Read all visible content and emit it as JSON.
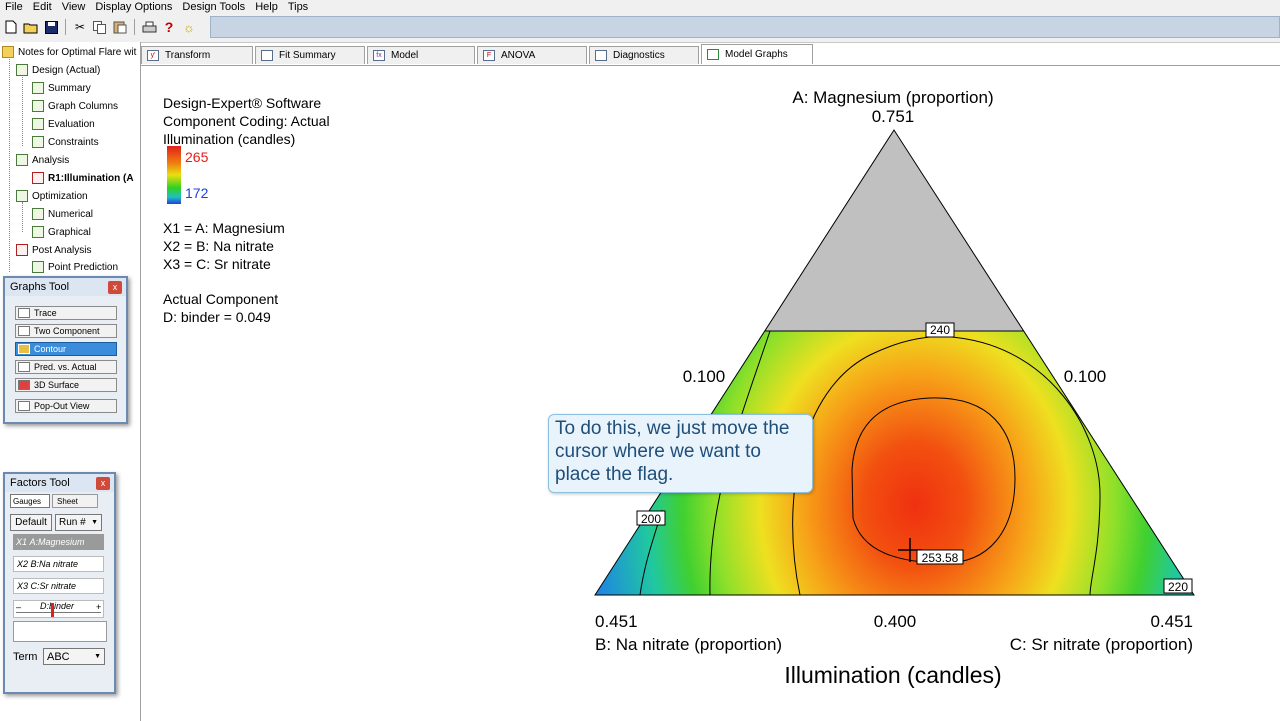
{
  "menu": [
    "File",
    "Edit",
    "View",
    "Display Options",
    "Design Tools",
    "Help",
    "Tips"
  ],
  "tree": {
    "root": "Notes for Optimal Flare wit",
    "items": [
      {
        "label": "Design (Actual)",
        "level": 1
      },
      {
        "label": "Summary",
        "level": 2
      },
      {
        "label": "Graph Columns",
        "level": 2
      },
      {
        "label": "Evaluation",
        "level": 2
      },
      {
        "label": "Constraints",
        "level": 2
      },
      {
        "label": "Analysis",
        "level": 1
      },
      {
        "label": "R1:Illumination (A",
        "level": 2
      },
      {
        "label": "Optimization",
        "level": 1
      },
      {
        "label": "Numerical",
        "level": 2
      },
      {
        "label": "Graphical",
        "level": 2
      },
      {
        "label": "Post Analysis",
        "level": 1
      },
      {
        "label": "Point Prediction",
        "level": 2
      }
    ]
  },
  "graphs_tool": {
    "title": "Graphs Tool",
    "close": "x",
    "buttons": [
      "Trace",
      "Two Component",
      "Contour",
      "Pred. vs. Actual",
      "3D Surface",
      "Pop-Out View"
    ],
    "active": "Contour"
  },
  "factors_tool": {
    "title": "Factors Tool",
    "close": "x",
    "tab_gauges": "Gauges",
    "tab_sheet": "Sheet",
    "default_label": "Default",
    "run_label": "Run #",
    "factor_rows": [
      {
        "tag": "X1",
        "label": "A:Magnesium",
        "selected": true
      },
      {
        "tag": "X2",
        "label": "B:Na nitrate",
        "selected": false
      },
      {
        "tag": "X3",
        "label": "C:Sr nitrate",
        "selected": false
      }
    ],
    "slider_minus": "–",
    "slider_plus": "+",
    "slider_label": "D:binder",
    "term_label": "Term",
    "term_value": "ABC"
  },
  "tabs": [
    {
      "label": "Transform",
      "icon": "y-prime-icon"
    },
    {
      "label": "Fit Summary",
      "icon": "table-icon"
    },
    {
      "label": "Model",
      "icon": "fx-icon"
    },
    {
      "label": "ANOVA",
      "icon": "anova-icon"
    },
    {
      "label": "Diagnostics",
      "icon": "diagnostics-icon"
    },
    {
      "label": "Model Graphs",
      "icon": "graph-icon"
    }
  ],
  "active_tab": "Model Graphs",
  "info": {
    "software": "Design-Expert® Software",
    "coding": "Component Coding: Actual",
    "response": "Illumination (candles)",
    "legend_high": "265",
    "legend_low": "172",
    "x1": "X1 = A: Magnesium",
    "x2": "X2 = B: Na nitrate",
    "x3": "X3 = C: Sr nitrate",
    "actual_component": "Actual Component",
    "binder": "D: binder = 0.049"
  },
  "chart_data": {
    "type": "contour",
    "title": "Illumination (candles)",
    "vertex_top": {
      "label": "A: Magnesium (proportion)",
      "value": "0.751"
    },
    "vertex_left": {
      "label": "B: Na nitrate (proportion)",
      "value": "0.451"
    },
    "vertex_right": {
      "label": "C: Sr nitrate (proportion)",
      "value": "0.451"
    },
    "edge_left": "0.100",
    "edge_right": "0.100",
    "edge_bottom": "0.400",
    "contour_labels": [
      "240",
      "200",
      "220"
    ],
    "flag_value": "253.58",
    "color_range": [
      172,
      265
    ]
  },
  "callout": {
    "text": "To do this, we just move the cursor where we want to place the flag."
  }
}
